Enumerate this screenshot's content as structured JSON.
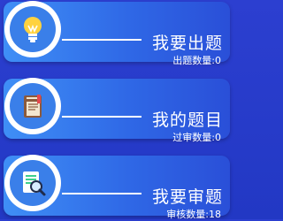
{
  "cards": [
    {
      "title": "我要出题",
      "count_text": "出题数量:0",
      "icon": "lightbulb-icon"
    },
    {
      "title": "我的题目",
      "count_text": "过审数量:0",
      "icon": "notebook-icon"
    },
    {
      "title": "我要审题",
      "count_text": "审核数量:18",
      "icon": "document-search-icon"
    }
  ],
  "colors": {
    "background": "#2c3fd0",
    "card_start": "#3f8ff6",
    "card_end": "#2a4fd8",
    "icon_circle": "#3a7fe9"
  }
}
